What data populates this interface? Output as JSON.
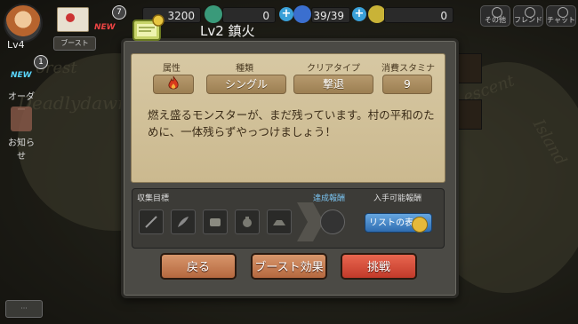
{
  "topbar": {
    "gold": "3200",
    "gems": "0",
    "stamina": "39/39",
    "points": "0",
    "menu_buttons": [
      {
        "label": "その他",
        "icon": "gear-icon"
      },
      {
        "label": "フレンド",
        "icon": "friends-icon"
      },
      {
        "label": "チャット",
        "icon": "chat-icon"
      }
    ],
    "mail_badge": "7",
    "new_label": "NEW"
  },
  "player": {
    "level": "Lv4",
    "boost_label": "ブースト"
  },
  "sidebar": {
    "order_badge": "1",
    "order_new": "NEW",
    "order_label": "オーダー",
    "news_label": "お知らせ"
  },
  "map": {
    "texts": [
      "orest",
      "Deadlydawn",
      "escent",
      "Island"
    ]
  },
  "dialog": {
    "title": "Lv2  鎮火",
    "headers": [
      "属性",
      "種類",
      "クリアタイプ",
      "消費スタミナ"
    ],
    "type": "シングル",
    "clear_type": "撃退",
    "stamina_cost": "9",
    "description": "燃え盛るモンスターが、まだ残っています。村の平和のために、一体残らずやっつけましょう！",
    "collect_label": "収集目標",
    "achieve_label": "達成報酬",
    "obtain_label": "入手可能報酬",
    "list_button": "リストの表示",
    "buttons": {
      "back": "戻る",
      "boost": "ブースト効果",
      "challenge": "挑戦"
    },
    "colors": {
      "fire": "#d8391c",
      "challenge": "#d44a36",
      "tan": "#c47b52"
    }
  }
}
